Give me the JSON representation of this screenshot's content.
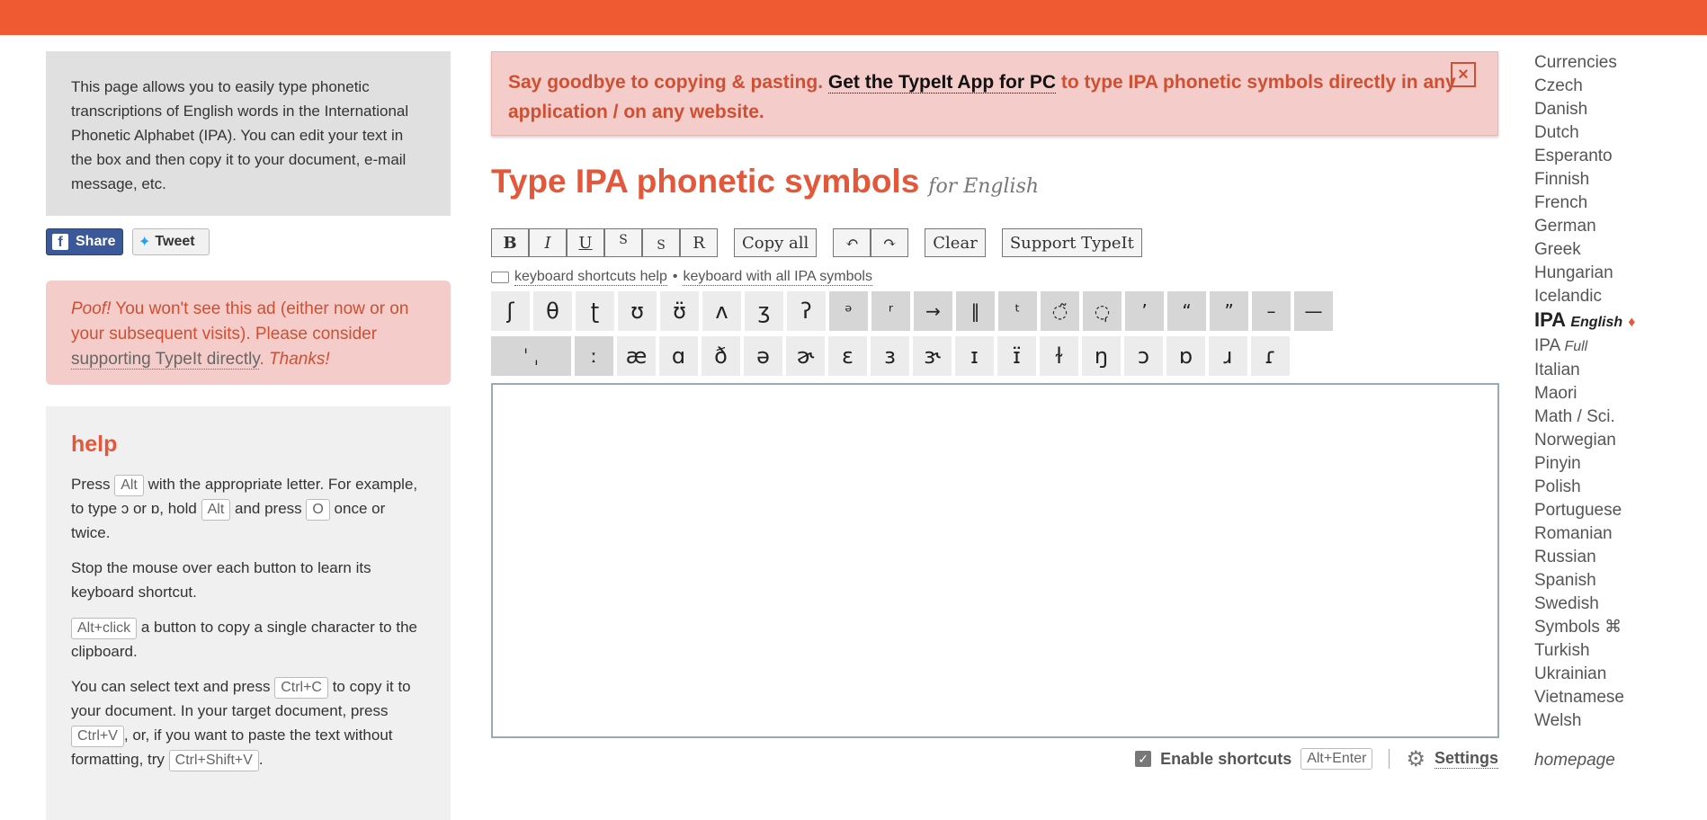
{
  "colors": {
    "accent": "#f05a33",
    "promo_bg": "#f4cdca",
    "title": "#e3573a"
  },
  "intro": {
    "text": "This page allows you to easily type phonetic transcriptions of English words in the International Phonetic Alphabet (IPA). You can edit your text in the box and then copy it to your document, e-mail message, etc."
  },
  "social": {
    "share_label": "Share",
    "tweet_label": "Tweet"
  },
  "ad_notice": {
    "poof": "Poof!",
    "text_part1": " You won't see this ad (either now or on your subsequent visits). Please consider ",
    "link": "supporting TypeIt directly",
    "text_part2": ". ",
    "thanks": "Thanks!"
  },
  "help": {
    "title": "help",
    "p1_a": "Press ",
    "p1_key_alt": "Alt",
    "p1_b": " with the appropriate letter. For example, to type ɔ or ɒ, hold ",
    "p1_key_alt2": "Alt",
    "p1_c": " and press ",
    "p1_key_o": "O",
    "p1_d": " once or twice.",
    "p2": "Stop the mouse over each button to learn its keyboard shortcut.",
    "p3_key": "Alt+click",
    "p3_text": " a button to copy a single character to the clipboard.",
    "p4_a": "You can select text and press ",
    "p4_key_ctrlc": "Ctrl+C",
    "p4_b": " to copy it to your document. In your target document, press ",
    "p4_key_ctrlv": "Ctrl+V",
    "p4_c": ", or, if you want to paste the text without formatting, try ",
    "p4_key_ctrlshiftv": "Ctrl+Shift+V",
    "p4_d": "."
  },
  "promo": {
    "text_a": "Say goodbye to copying & pasting. ",
    "app_link": "Get the TypeIt App for PC",
    "text_b": " to type IPA phonetic symbols directly in any application / on any website.",
    "close": "×"
  },
  "page": {
    "title": "Type IPA phonetic symbols",
    "subtitle": "for English"
  },
  "toolbar": {
    "bold": "B",
    "italic": "I",
    "underline": "U",
    "superscript": "S",
    "subscript": "S",
    "regular": "R",
    "copy_all": "Copy all",
    "undo": "↶",
    "redo": "↷",
    "clear": "Clear",
    "support": "Support TypeIt"
  },
  "links": {
    "shortcuts_help": "keyboard shortcuts help",
    "separator": "•",
    "all_symbols": "keyboard with all IPA symbols"
  },
  "ipa_row1": [
    "ʃ",
    "θ",
    "ʈ",
    "ʊ",
    "ʊ̈",
    "ʌ",
    "ʒ",
    "ʔ",
    "ᵊ",
    "ʳ",
    "→",
    "‖",
    "ᵗ",
    "◌̃",
    "◌̩",
    "’",
    "“",
    "”",
    "–",
    "—"
  ],
  "ipa_row2": [
    "ˈ ˌ",
    "ː",
    "æ",
    "ɑ",
    "ð",
    "ə",
    "ɚ",
    "ɛ",
    "ɜ",
    "ɝ",
    "ɪ",
    "ɪ̈",
    "ɫ",
    "ŋ",
    "ɔ",
    "ɒ",
    "ɹ",
    "ɾ"
  ],
  "bottom": {
    "enable_shortcuts": "Enable shortcuts",
    "shortcut_key": "Alt+Enter",
    "settings": "Settings"
  },
  "languages": [
    "Currencies",
    "Czech",
    "Danish",
    "Dutch",
    "Esperanto",
    "Finnish",
    "French",
    "German",
    "Greek",
    "Hungarian",
    "Icelandic"
  ],
  "lang_active": {
    "name": "IPA",
    "sub": "English",
    "mark": "♦"
  },
  "lang_ipa_full": {
    "name": "IPA",
    "sub": "Full"
  },
  "languages_after": [
    "Italian",
    "Maori",
    "Math / Sci.",
    "Norwegian",
    "Pinyin",
    "Polish",
    "Portuguese",
    "Romanian",
    "Russian",
    "Spanish",
    "Swedish",
    "Symbols ⌘",
    "Turkish",
    "Ukrainian",
    "Vietnamese",
    "Welsh"
  ],
  "homepage": "homepage"
}
